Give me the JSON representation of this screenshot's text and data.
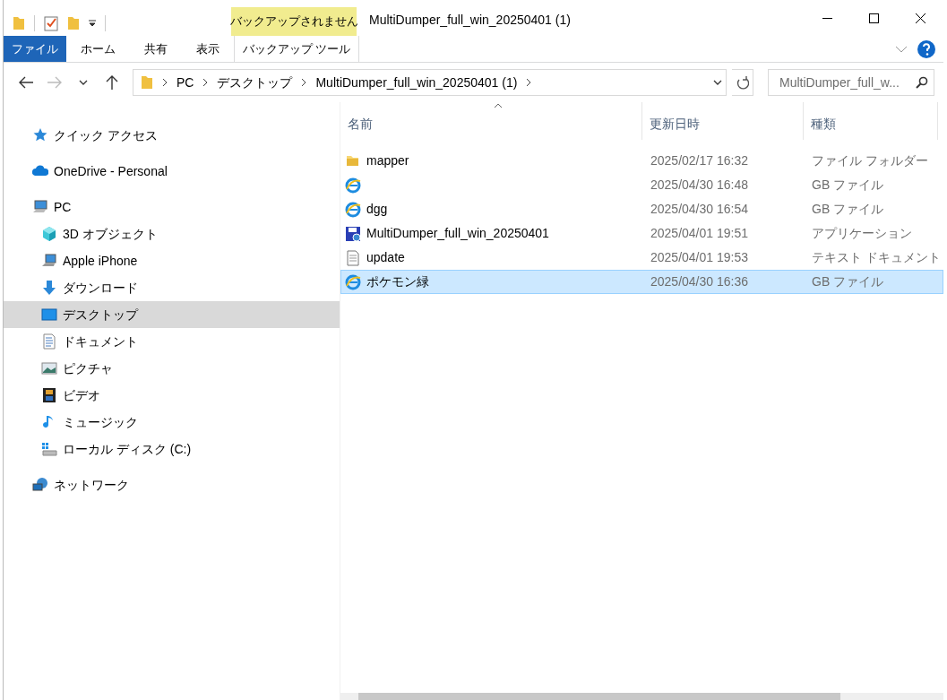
{
  "title_bar": {
    "context_group": "バックアップされません",
    "title": "MultiDumper_full_win_20250401 (1)"
  },
  "ribbon": {
    "tabs": [
      {
        "label": "ファイル",
        "kind": "file"
      },
      {
        "label": "ホーム",
        "kind": "tab"
      },
      {
        "label": "共有",
        "kind": "tab"
      },
      {
        "label": "表示",
        "kind": "tab"
      },
      {
        "label": "バックアップ ツール",
        "kind": "context"
      }
    ]
  },
  "address": {
    "breadcrumb": [
      "PC",
      "デスクトップ",
      "MultiDumper_full_win_20250401 (1)"
    ],
    "search": {
      "placeholder": "MultiDumper_full_w..."
    }
  },
  "navigation": {
    "items": [
      {
        "label": "クイック アクセス",
        "kind": "star",
        "selected": false
      },
      {
        "label": "OneDrive - Personal",
        "kind": "cloud",
        "selected": false
      },
      {
        "label": "PC",
        "kind": "pc",
        "selected": false,
        "children": [
          {
            "label": "3D オブジェクト",
            "kind": "cube",
            "selected": false
          },
          {
            "label": "Apple iPhone",
            "kind": "device",
            "selected": false
          },
          {
            "label": "ダウンロード",
            "kind": "download",
            "selected": false
          },
          {
            "label": "デスクトップ",
            "kind": "desktop",
            "selected": true
          },
          {
            "label": "ドキュメント",
            "kind": "document",
            "selected": false
          },
          {
            "label": "ピクチャ",
            "kind": "picture",
            "selected": false
          },
          {
            "label": "ビデオ",
            "kind": "video",
            "selected": false
          },
          {
            "label": "ミュージック",
            "kind": "music",
            "selected": false
          },
          {
            "label": "ローカル ディスク (C:)",
            "kind": "drive",
            "selected": false
          }
        ]
      },
      {
        "label": "ネットワーク",
        "kind": "network",
        "selected": false
      }
    ]
  },
  "file_list": {
    "columns": [
      {
        "label": "名前",
        "sorted": true
      },
      {
        "label": "更新日時",
        "sorted": false
      },
      {
        "label": "種類",
        "sorted": false
      }
    ],
    "rows": [
      {
        "name": "mapper",
        "modified": "2025/02/17 16:32",
        "type": "ファイル フォルダー",
        "kind": "folder",
        "selected": false
      },
      {
        "modified": "2025/04/30 16:48",
        "type": "GB ファイル",
        "kind": "web",
        "selected": false
      },
      {
        "name": "dgg",
        "modified": "2025/04/30 16:54",
        "type": "GB ファイル",
        "kind": "web",
        "selected": false
      },
      {
        "name": "MultiDumper_full_win_20250401",
        "modified": "2025/04/01 19:51",
        "type": "アプリケーション",
        "kind": "app",
        "selected": false
      },
      {
        "name": "update",
        "modified": "2025/04/01 19:53",
        "type": "テキスト ドキュメント",
        "kind": "text",
        "selected": false
      },
      {
        "name": "ポケモン緑",
        "modified": "2025/04/30 16:36",
        "type": "GB ファイル",
        "kind": "web",
        "selected": true
      }
    ]
  }
}
